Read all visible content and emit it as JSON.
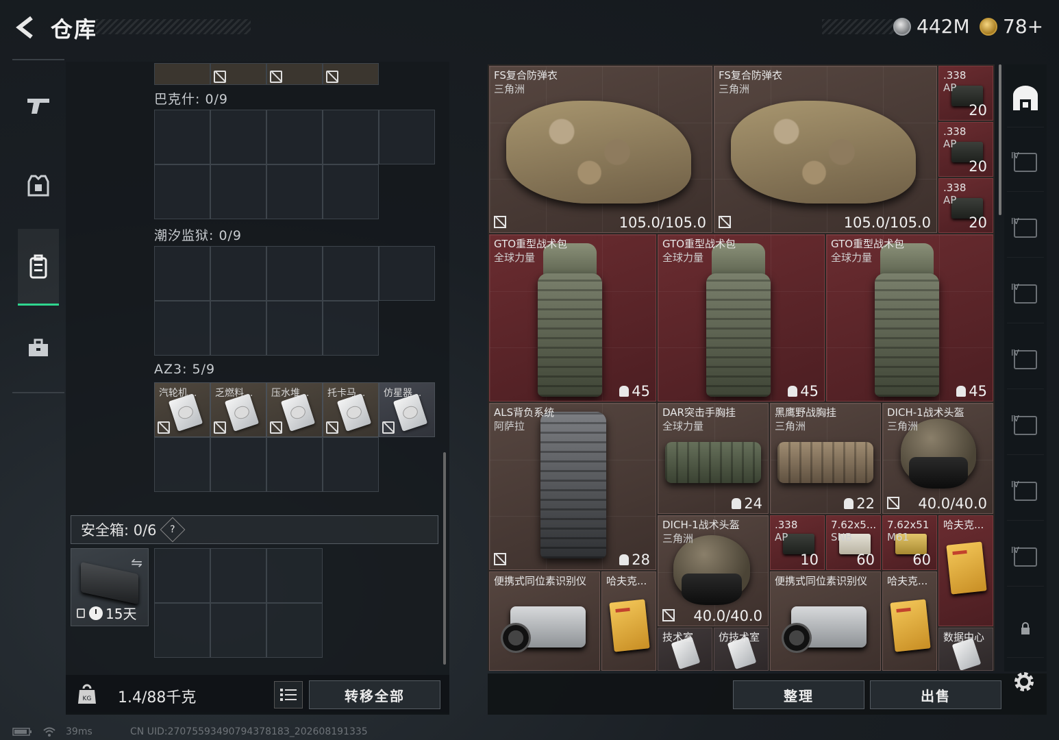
{
  "header": {
    "title": "仓库",
    "currency_silver": "442M",
    "currency_gold": "78+"
  },
  "left_nav": [
    "weapon-icon",
    "armor-icon",
    "backpack-icon",
    "toolbox-icon"
  ],
  "containers": {
    "bakshi": {
      "label": "巴克什: 0/9"
    },
    "tide_prison": {
      "label": "潮汐监狱: 0/9"
    },
    "az3": {
      "label": "AZ3: 5/9",
      "items": [
        "汽轮机...",
        "乏燃料...",
        "压水堆...",
        "托卡马...",
        "仿星器..."
      ]
    },
    "safebox": {
      "label": "安全箱: 0/6",
      "help": "?",
      "days": "15天"
    }
  },
  "footer_left": {
    "weight": "1.4/88千克",
    "transfer_all": "转移全部"
  },
  "inventory": {
    "vest1": {
      "name": "FS复合防弹衣",
      "sub": "三角洲",
      "durability": "105.0/105.0"
    },
    "vest2": {
      "name": "FS复合防弹衣",
      "sub": "三角洲",
      "durability": "105.0/105.0"
    },
    "ammo338_1": {
      "name": ".338",
      "sub": "AP",
      "count": "20"
    },
    "ammo338_2": {
      "name": ".338",
      "sub": "AP",
      "count": "20"
    },
    "ammo338_3": {
      "name": ".338",
      "sub": "AP",
      "count": "20"
    },
    "gto1": {
      "name": "GTO重型战术包",
      "sub": "全球力量",
      "capacity": "45"
    },
    "gto2": {
      "name": "GTO重型战术包",
      "sub": "全球力量",
      "capacity": "45"
    },
    "gto3": {
      "name": "GTO重型战术包",
      "sub": "全球力量",
      "capacity": "45"
    },
    "als": {
      "name": "ALS背负系统",
      "sub": "阿萨拉",
      "capacity": "28"
    },
    "dar": {
      "name": "DAR突击手胸挂",
      "sub": "全球力量",
      "capacity": "24"
    },
    "blackhawk": {
      "name": "黑鹰野战胸挂",
      "sub": "三角洲",
      "capacity": "22"
    },
    "dich1": {
      "name": "DICH-1战术头盔",
      "sub": "三角洲",
      "durability": "40.0/40.0"
    },
    "dich2": {
      "name": "DICH-1战术头盔",
      "sub": "三角洲",
      "durability": "40.0/40.0"
    },
    "ammo338_4": {
      "name": ".338",
      "sub": "AP",
      "count": "10"
    },
    "ammo762sns": {
      "name": "7.62x5...",
      "sub": "SNB",
      "count": "60"
    },
    "ammo762m61": {
      "name": "7.62x51",
      "sub": "M61",
      "count": "60"
    },
    "hafuke1": {
      "name": "哈夫克..."
    },
    "hafuke2": {
      "name": "哈夫克..."
    },
    "hafuke3": {
      "name": "哈夫克..."
    },
    "isotope1": {
      "name": "便携式同位素识别仪"
    },
    "isotope2": {
      "name": "便携式同位素识别仪"
    },
    "techroom": {
      "name": "技术室"
    },
    "fangji": {
      "name": "仿技术室"
    },
    "datacenter": {
      "name": "数据中心"
    }
  },
  "footer_right": {
    "sort": "整理",
    "sell": "出售"
  },
  "rail_levels": [
    "IV",
    "IV",
    "IV",
    "IV",
    "IV",
    "IV",
    "IV"
  ],
  "status": {
    "ping": "39ms",
    "uid": "CN UID:2707559349079437818З_202608191335"
  }
}
